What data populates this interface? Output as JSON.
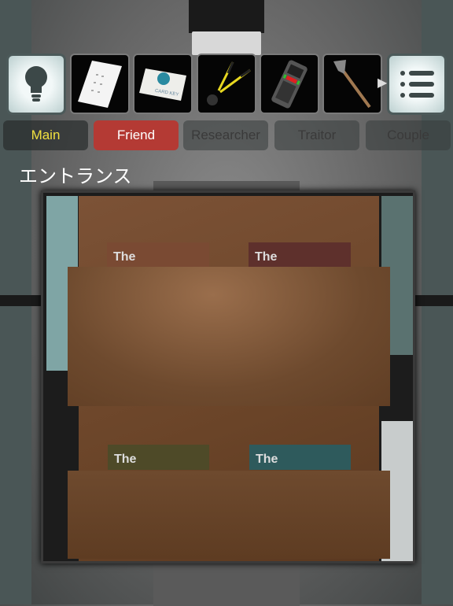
{
  "inventory": {
    "hint_button": {
      "icon": "lightbulb-icon"
    },
    "items": [
      {
        "name": "paper-note",
        "icon": "paper-note-icon"
      },
      {
        "name": "card-key",
        "icon": "card-key-icon",
        "label": "CARD KEY"
      },
      {
        "name": "bolt-cutter",
        "icon": "bolt-cutter-icon"
      },
      {
        "name": "card-reader",
        "icon": "card-reader-icon"
      },
      {
        "name": "axe",
        "icon": "axe-icon"
      }
    ],
    "scroll_arrow": "▶",
    "menu_button": {
      "icon": "list-menu-icon"
    }
  },
  "tabs": [
    {
      "label": "Main",
      "color": "#f0e040",
      "bg": "rgba(40,44,44,.7)"
    },
    {
      "label": "Friend",
      "color": "#ffffff",
      "bg": "#b43a34",
      "selected": true
    },
    {
      "label": "Researcher"
    },
    {
      "label": "Traitor"
    },
    {
      "label": "Couple"
    }
  ],
  "location_title": "エントランス",
  "scene": {
    "magazines": [
      {
        "label": "The",
        "color": "#7a4a33"
      },
      {
        "label": "The",
        "color": "#5e302c"
      },
      {
        "label": "The",
        "color": "#4e4a28"
      },
      {
        "label": "The",
        "color": "#2e5a5c"
      }
    ]
  }
}
